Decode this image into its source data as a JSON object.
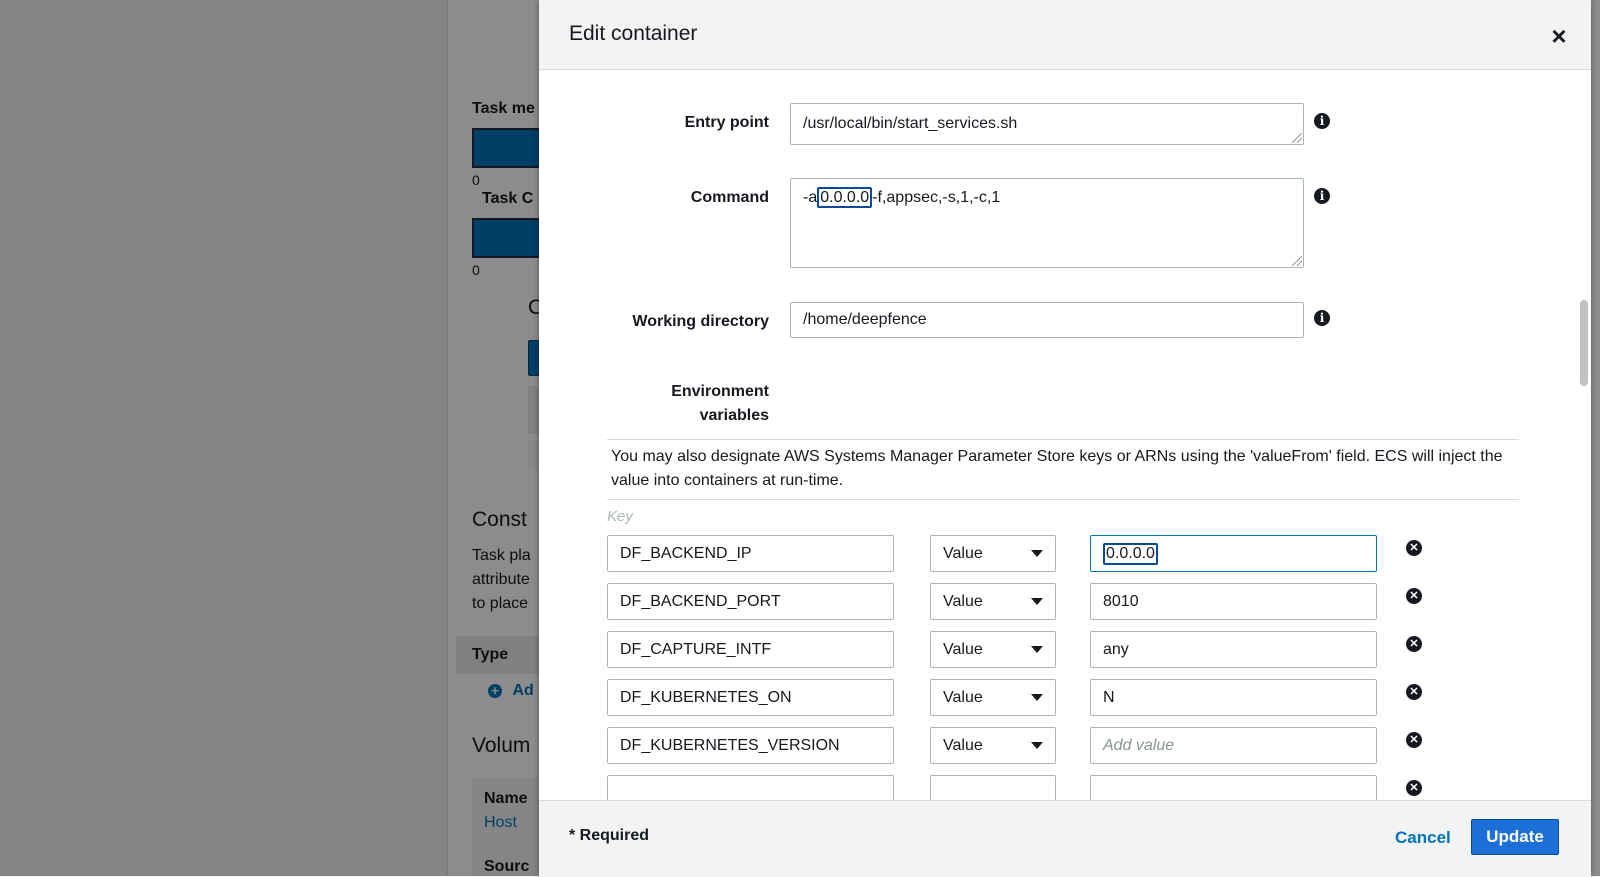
{
  "background": {
    "task_memory_label": "Task me",
    "task_cpu_label": "Task C",
    "zero_1": "0",
    "zero_2": "0",
    "constraints_heading": "Const",
    "constraints_text": [
      "Task pla",
      "attribute",
      "to place"
    ],
    "type_header": "Type",
    "add_link": "Ad",
    "volumes_heading": "Volum",
    "name_label": "Name",
    "host_link": "Host",
    "source_label": "Sourc",
    "c_heading": "C"
  },
  "modal": {
    "title": "Edit container",
    "close_symbol": "×",
    "fields": {
      "entry_point": {
        "label": "Entry point",
        "value": "/usr/local/bin/start_services.sh"
      },
      "command": {
        "label": "Command",
        "value_prefix": "-a",
        "value_selected": "0.0.0.0",
        "value_suffix": "-f,appsec,-s,1,-c,1"
      },
      "working_directory": {
        "label": "Working directory",
        "value": "/home/deepfence"
      },
      "environment": {
        "label_line1": "Environment",
        "label_line2": "variables"
      }
    },
    "env_note": "You may also designate AWS Systems Manager Parameter Store keys or ARNs using the 'valueFrom' field. ECS will inject the value into containers at run-time.",
    "key_header": "Key",
    "env_rows": [
      {
        "key": "DF_BACKEND_IP",
        "type": "Value",
        "value": "0.0.0.0",
        "placeholder": ""
      },
      {
        "key": "DF_BACKEND_PORT",
        "type": "Value",
        "value": "8010",
        "placeholder": ""
      },
      {
        "key": "DF_CAPTURE_INTF",
        "type": "Value",
        "value": "any",
        "placeholder": ""
      },
      {
        "key": "DF_KUBERNETES_ON",
        "type": "Value",
        "value": "N",
        "placeholder": ""
      },
      {
        "key": "DF_KUBERNETES_VERSION",
        "type": "Value",
        "value": "",
        "placeholder": "Add value"
      }
    ],
    "info_symbol": "i",
    "remove_symbol": "✕",
    "footer": {
      "required_note": "* Required",
      "cancel_label": "Cancel",
      "update_label": "Update"
    }
  }
}
